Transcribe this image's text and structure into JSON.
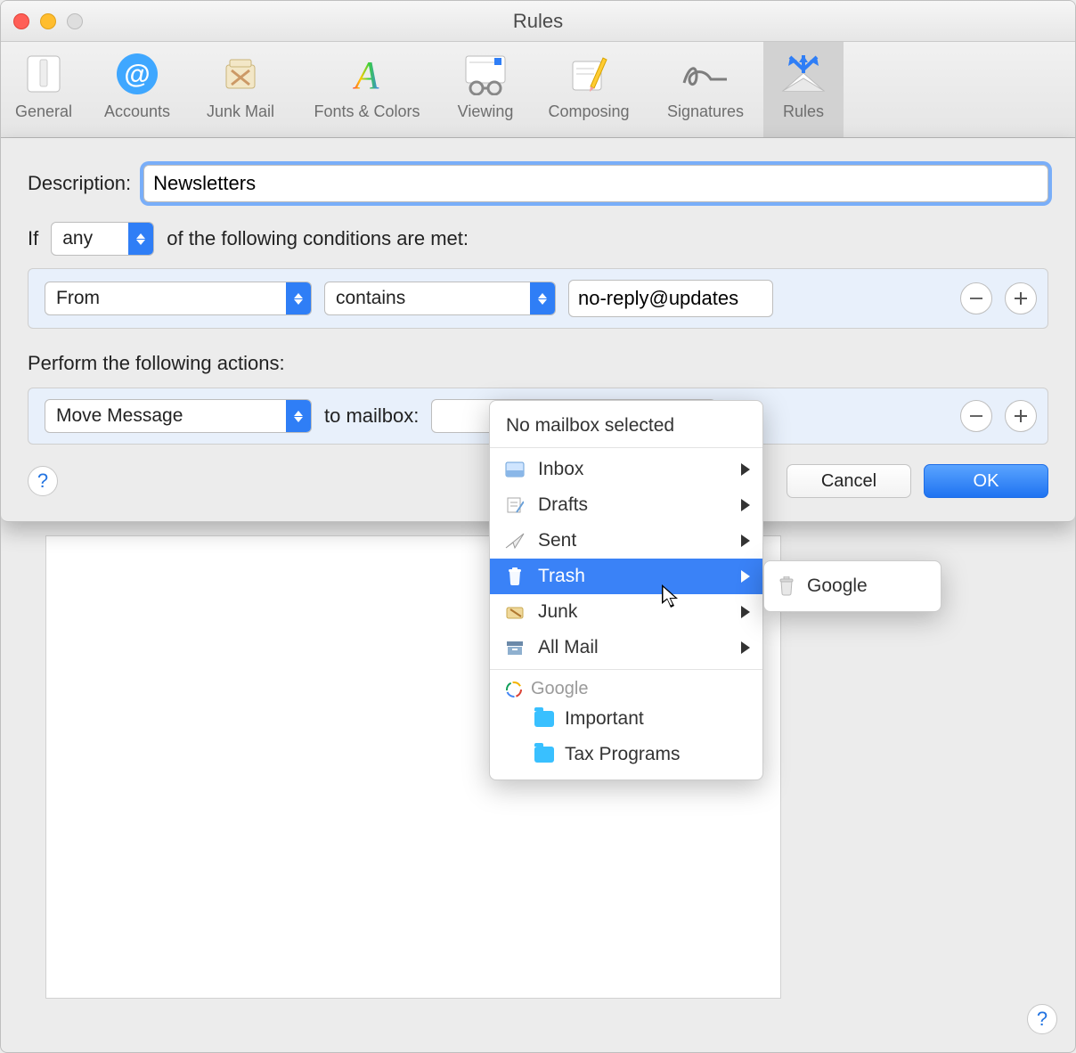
{
  "window": {
    "title": "Rules"
  },
  "toolbar": {
    "items": [
      {
        "id": "general",
        "label": "General"
      },
      {
        "id": "accounts",
        "label": "Accounts"
      },
      {
        "id": "junk",
        "label": "Junk Mail"
      },
      {
        "id": "fonts",
        "label": "Fonts & Colors"
      },
      {
        "id": "viewing",
        "label": "Viewing"
      },
      {
        "id": "composing",
        "label": "Composing"
      },
      {
        "id": "signatures",
        "label": "Signatures"
      },
      {
        "id": "rules",
        "label": "Rules"
      }
    ],
    "selected": "rules"
  },
  "sheet": {
    "description_label": "Description:",
    "description_value": "Newsletters",
    "if_label": "If",
    "match_mode": "any",
    "if_suffix": "of the following conditions are met:",
    "condition": {
      "field": "From",
      "operator": "contains",
      "value": "no-reply@updates"
    },
    "actions_label": "Perform the following actions:",
    "action": {
      "type": "Move Message",
      "to_label": "to mailbox:",
      "mailbox_placeholder": "No mailbox selected"
    },
    "buttons": {
      "cancel": "Cancel",
      "ok": "OK"
    }
  },
  "popup": {
    "header": "No mailbox selected",
    "items": [
      {
        "icon": "inbox",
        "label": "Inbox",
        "sub": true
      },
      {
        "icon": "drafts",
        "label": "Drafts",
        "sub": true
      },
      {
        "icon": "sent",
        "label": "Sent",
        "sub": true
      },
      {
        "icon": "trash",
        "label": "Trash",
        "sub": true,
        "highlight": true
      },
      {
        "icon": "junk",
        "label": "Junk",
        "sub": true
      },
      {
        "icon": "allmail",
        "label": "All Mail",
        "sub": true
      }
    ],
    "group": {
      "icon": "google",
      "label": "Google"
    },
    "folders": [
      {
        "label": "Important"
      },
      {
        "label": "Tax Programs"
      }
    ]
  },
  "submenu": {
    "icon": "trash",
    "label": "Google"
  },
  "colors": {
    "accent": "#2f7ef6",
    "highlight": "#3a82f7"
  }
}
